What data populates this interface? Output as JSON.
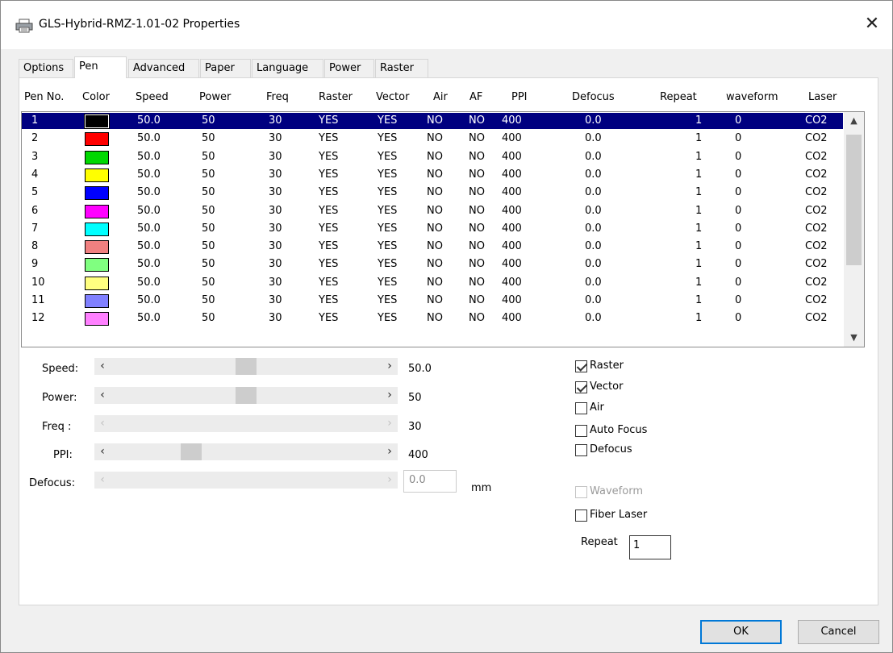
{
  "window": {
    "title": "GLS-Hybrid-RMZ-1.01-02 Properties"
  },
  "tabs": [
    {
      "label": "Options"
    },
    {
      "label": "Pen"
    },
    {
      "label": "Advanced"
    },
    {
      "label": "Paper"
    },
    {
      "label": "Language"
    },
    {
      "label": "Power"
    },
    {
      "label": "Raster"
    }
  ],
  "active_tab": "Pen",
  "table": {
    "headers": [
      "Pen No.",
      "Color",
      "Speed",
      "Power",
      "Freq",
      "Raster",
      "Vector",
      "Air",
      "AF",
      "PPI",
      "Defocus",
      "Repeat",
      "waveform",
      "Laser"
    ],
    "rows": [
      {
        "no": "1",
        "color": "#000000",
        "speed": "50.0",
        "power": "50",
        "freq": "30",
        "raster": "YES",
        "vector": "YES",
        "air": "NO",
        "af": "NO",
        "ppi": "400",
        "defocus": "0.0",
        "repeat": "1",
        "waveform": "0",
        "laser": "CO2"
      },
      {
        "no": "2",
        "color": "#ff0000",
        "speed": "50.0",
        "power": "50",
        "freq": "30",
        "raster": "YES",
        "vector": "YES",
        "air": "NO",
        "af": "NO",
        "ppi": "400",
        "defocus": "0.0",
        "repeat": "1",
        "waveform": "0",
        "laser": "CO2"
      },
      {
        "no": "3",
        "color": "#00d800",
        "speed": "50.0",
        "power": "50",
        "freq": "30",
        "raster": "YES",
        "vector": "YES",
        "air": "NO",
        "af": "NO",
        "ppi": "400",
        "defocus": "0.0",
        "repeat": "1",
        "waveform": "0",
        "laser": "CO2"
      },
      {
        "no": "4",
        "color": "#ffff00",
        "speed": "50.0",
        "power": "50",
        "freq": "30",
        "raster": "YES",
        "vector": "YES",
        "air": "NO",
        "af": "NO",
        "ppi": "400",
        "defocus": "0.0",
        "repeat": "1",
        "waveform": "0",
        "laser": "CO2"
      },
      {
        "no": "5",
        "color": "#0000ff",
        "speed": "50.0",
        "power": "50",
        "freq": "30",
        "raster": "YES",
        "vector": "YES",
        "air": "NO",
        "af": "NO",
        "ppi": "400",
        "defocus": "0.0",
        "repeat": "1",
        "waveform": "0",
        "laser": "CO2"
      },
      {
        "no": "6",
        "color": "#ff00ff",
        "speed": "50.0",
        "power": "50",
        "freq": "30",
        "raster": "YES",
        "vector": "YES",
        "air": "NO",
        "af": "NO",
        "ppi": "400",
        "defocus": "0.0",
        "repeat": "1",
        "waveform": "0",
        "laser": "CO2"
      },
      {
        "no": "7",
        "color": "#00ffff",
        "speed": "50.0",
        "power": "50",
        "freq": "30",
        "raster": "YES",
        "vector": "YES",
        "air": "NO",
        "af": "NO",
        "ppi": "400",
        "defocus": "0.0",
        "repeat": "1",
        "waveform": "0",
        "laser": "CO2"
      },
      {
        "no": "8",
        "color": "#f08080",
        "speed": "50.0",
        "power": "50",
        "freq": "30",
        "raster": "YES",
        "vector": "YES",
        "air": "NO",
        "af": "NO",
        "ppi": "400",
        "defocus": "0.0",
        "repeat": "1",
        "waveform": "0",
        "laser": "CO2"
      },
      {
        "no": "9",
        "color": "#80ff80",
        "speed": "50.0",
        "power": "50",
        "freq": "30",
        "raster": "YES",
        "vector": "YES",
        "air": "NO",
        "af": "NO",
        "ppi": "400",
        "defocus": "0.0",
        "repeat": "1",
        "waveform": "0",
        "laser": "CO2"
      },
      {
        "no": "10",
        "color": "#ffff80",
        "speed": "50.0",
        "power": "50",
        "freq": "30",
        "raster": "YES",
        "vector": "YES",
        "air": "NO",
        "af": "NO",
        "ppi": "400",
        "defocus": "0.0",
        "repeat": "1",
        "waveform": "0",
        "laser": "CO2"
      },
      {
        "no": "11",
        "color": "#8080ff",
        "speed": "50.0",
        "power": "50",
        "freq": "30",
        "raster": "YES",
        "vector": "YES",
        "air": "NO",
        "af": "NO",
        "ppi": "400",
        "defocus": "0.0",
        "repeat": "1",
        "waveform": "0",
        "laser": "CO2"
      },
      {
        "no": "12",
        "color": "#ff80ff",
        "speed": "50.0",
        "power": "50",
        "freq": "30",
        "raster": "YES",
        "vector": "YES",
        "air": "NO",
        "af": "NO",
        "ppi": "400",
        "defocus": "0.0",
        "repeat": "1",
        "waveform": "0",
        "laser": "CO2"
      }
    ],
    "selected_row_index": 0,
    "selection_color": "#000080"
  },
  "controls": {
    "speed": {
      "label": "Speed:",
      "value": "50.0",
      "level": 0.5,
      "enabled": true
    },
    "power": {
      "label": "Power:",
      "value": "50",
      "level": 0.5,
      "enabled": true
    },
    "freq": {
      "label": "Freq :",
      "value": "30",
      "enabled": false
    },
    "ppi": {
      "label": "PPI:",
      "value": "400",
      "level": 0.28,
      "enabled": true
    },
    "defocus": {
      "label": "Defocus:",
      "value": "0.0",
      "unit": "mm",
      "enabled": false
    }
  },
  "options": {
    "raster": {
      "label": "Raster",
      "checked": true
    },
    "vector": {
      "label": "Vector",
      "checked": true
    },
    "air": {
      "label": "Air",
      "checked": false
    },
    "auto_focus": {
      "label": "Auto Focus",
      "checked": false
    },
    "defocus": {
      "label": "Defocus",
      "checked": false
    },
    "waveform": {
      "label": "Waveform",
      "checked": false,
      "enabled": false
    },
    "fiber_laser": {
      "label": "Fiber Laser",
      "checked": false
    }
  },
  "repeat": {
    "label": "Repeat",
    "value": "1"
  },
  "buttons": {
    "ok": "OK",
    "cancel": "Cancel"
  }
}
